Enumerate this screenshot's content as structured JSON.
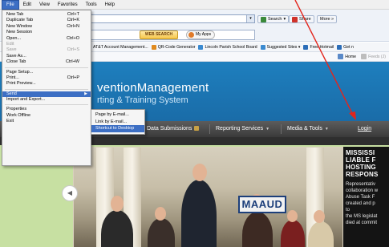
{
  "menubar": {
    "items": [
      {
        "label": "File",
        "active": true
      },
      {
        "label": "Edit",
        "active": false
      },
      {
        "label": "View",
        "active": false
      },
      {
        "label": "Favorites",
        "active": false
      },
      {
        "label": "Tools",
        "active": false
      },
      {
        "label": "Help",
        "active": false
      }
    ]
  },
  "toolbar": {
    "search_label": "Search",
    "share_label": "Share",
    "more_label": "More »",
    "websearch_label": "WEB SEARCH",
    "myapps_label": "My Apps"
  },
  "favorites": {
    "items": [
      "AT&T Account Management...",
      "QR-Code Generator",
      "Lincoln Parish School Board",
      "Suggested Sites ▾",
      "Free Hotmail",
      "Get n"
    ]
  },
  "tabbar": {
    "home_label": "Home",
    "feeds_label": "Feeds (J)"
  },
  "site": {
    "brand_line1": "ventionManagement",
    "brand_line2": "rting & Training System",
    "nav": {
      "data_submissions": "Data Submissions",
      "reporting_services": "Reporting Services",
      "media_tools": "Media & Tools",
      "login": "Login"
    },
    "banner_sign": "MAAUD",
    "news": {
      "title_lines": [
        "MISSISSI",
        "LIABLE F",
        "HOSTING",
        "RESPONS"
      ],
      "body_lines": [
        "Representativ",
        "collaboration w",
        "Abuse Task F",
        "created and p",
        "to",
        "the MS legislat",
        "died at commit"
      ]
    }
  },
  "file_menu": {
    "groups": [
      [
        {
          "label": "New Tab",
          "shortcut": "Ctrl+T",
          "disabled": false
        },
        {
          "label": "Duplicate Tab",
          "shortcut": "Ctrl+K",
          "disabled": false
        },
        {
          "label": "New Window",
          "shortcut": "Ctrl+N",
          "disabled": false
        },
        {
          "label": "New Session",
          "shortcut": "",
          "disabled": false
        },
        {
          "label": "Open...",
          "shortcut": "Ctrl+O",
          "disabled": false
        },
        {
          "label": "Edit",
          "shortcut": "",
          "disabled": true
        },
        {
          "label": "Save",
          "shortcut": "Ctrl+S",
          "disabled": true
        },
        {
          "label": "Save As...",
          "shortcut": "",
          "disabled": false
        },
        {
          "label": "Close Tab",
          "shortcut": "Ctrl+W",
          "disabled": false
        }
      ],
      [
        {
          "label": "Page Setup...",
          "shortcut": "",
          "disabled": false
        },
        {
          "label": "Print...",
          "shortcut": "Ctrl+P",
          "disabled": false
        },
        {
          "label": "Print Preview...",
          "shortcut": "",
          "disabled": false
        }
      ],
      [
        {
          "label": "Send",
          "shortcut": "",
          "disabled": false,
          "submenu": true,
          "highlight": true
        },
        {
          "label": "Import and Export...",
          "shortcut": "",
          "disabled": false
        }
      ],
      [
        {
          "label": "Properties",
          "shortcut": "",
          "disabled": false
        },
        {
          "label": "Work Offline",
          "shortcut": "",
          "disabled": false
        },
        {
          "label": "Exit",
          "shortcut": "",
          "disabled": false
        }
      ]
    ]
  },
  "send_submenu": {
    "items": [
      {
        "label": "Page by E-mail...",
        "highlight": false
      },
      {
        "label": "Link by E-mail...",
        "highlight": false
      },
      {
        "label": "Shortcut to Desktop",
        "highlight": true
      }
    ]
  },
  "colors": {
    "menu_highlight": "#3d6fc4",
    "annotation_arrow": "#e3251c",
    "header_blue": "#1e7fbe",
    "nav_gray": "#444444",
    "page_green": "#c7e0a2"
  }
}
